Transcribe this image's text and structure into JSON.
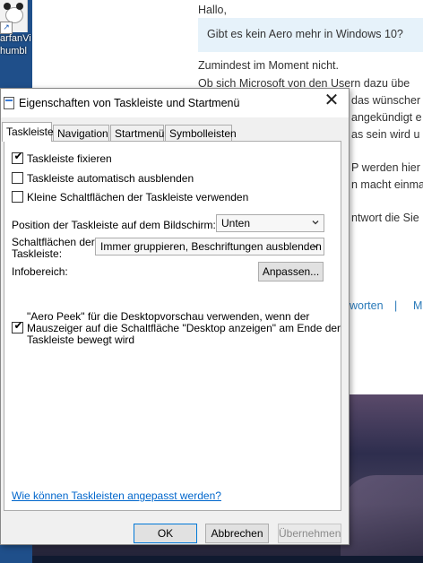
{
  "desktop": {
    "icon_label_1": "arfanVi",
    "icon_label_2": "humbl"
  },
  "background_page": {
    "greeting": "Hallo,",
    "quote": "Gibt es kein Aero mehr in Windows 10?",
    "line1": "Zumindest im Moment nicht.",
    "line2": "Ob sich Microsoft von den Usern dazu übe",
    "line3": "das wünscher",
    "line4": "angekündigt e",
    "line5": "as sein wird u",
    "line6": "P werden hier",
    "line7": "n macht einma",
    "line8": "ntwort die Sie",
    "action_reply": "worten",
    "separator": "|",
    "action_more": "M"
  },
  "dialog": {
    "title": "Eigenschaften von Taskleiste und Startmenü",
    "close_symbol": "✕",
    "tabs": [
      {
        "label": "Taskleiste",
        "active": true
      },
      {
        "label": "Navigation",
        "active": false
      },
      {
        "label": "Startmenü",
        "active": false
      },
      {
        "label": "Symbolleisten",
        "active": false
      }
    ],
    "checkboxes": [
      {
        "label": "Taskleiste fixieren",
        "checked": true
      },
      {
        "label": "Taskleiste automatisch ausblenden",
        "checked": false
      },
      {
        "label": "Kleine Schaltflächen der Taskleiste verwenden",
        "checked": false
      }
    ],
    "position_label": "Position der Taskleiste auf dem Bildschirm:",
    "position_value": "Unten",
    "buttons_label_line1": "Schaltflächen der",
    "buttons_label_line2": "Taskleiste:",
    "buttons_value": "Immer gruppieren, Beschriftungen ausblenden",
    "infobereich_label": "Infobereich:",
    "customize_button": "Anpassen...",
    "aero_peek": {
      "checked": true,
      "line0": "\"Aero Peek\" für die Desktopvorschau verwenden, wenn der",
      "line1": "Mauszeiger auf die Schaltfläche \"Desktop anzeigen\" am Ende der",
      "line2": "Taskleiste bewegt wird"
    },
    "help_link": "Wie können Taskleisten angepasst werden?",
    "ok_button": "OK",
    "cancel_button": "Abbrechen",
    "apply_button": "Übernehmen"
  },
  "icons": {
    "check_glyph": "✔"
  }
}
